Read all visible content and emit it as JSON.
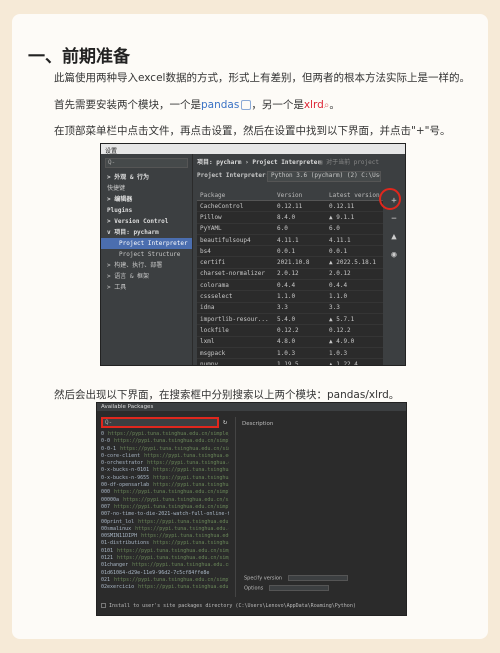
{
  "heading": "一、前期准备",
  "paragraphs": {
    "p1": "此篇使用两种导入excel数据的方式，形式上有差别，但两者的根本方法实际上是一样的。",
    "p2_before": "首先需要安装两个模块，一个是",
    "p2_pandas": "pandas",
    "p2_middle": "，另一个是",
    "p2_xlrd": "xlrd",
    "p2_end": "。",
    "p3": "在顶部菜单栏中点击文件，再点击设置，然后在设置中找到以下界面，并点击\"+\"号。",
    "p4": "然后会出现以下界面，在搜索框中分别搜索以上两个模块：pandas/xlrd。"
  },
  "settings": {
    "window_title": "设置",
    "search_placeholder": "Q-",
    "sidebar": [
      {
        "label": "> 外观 & 行为",
        "kind": "bold"
      },
      {
        "label": "  快捷键",
        "kind": "normal"
      },
      {
        "label": "> 编辑器",
        "kind": "bold"
      },
      {
        "label": "  Plugins",
        "kind": "bold"
      },
      {
        "label": "> Version Control",
        "kind": "bold"
      },
      {
        "label": "v 项目: pycharm",
        "kind": "bold"
      },
      {
        "label": "Project Interpreter",
        "kind": "active"
      },
      {
        "label": "Project Structure",
        "kind": "sub"
      },
      {
        "label": "> 构建、执行、部署",
        "kind": "normal"
      },
      {
        "label": "> 语言 & 框架",
        "kind": "normal"
      },
      {
        "label": "> 工具",
        "kind": "normal"
      }
    ],
    "breadcrumb": "项目: pycharm › Project Interpreter",
    "breadcrumb_right": "▣ 对于当前 project",
    "interpreter_label": "Project Interpreter:",
    "interpreter_value": "Python 3.6 (pycharm) (2) C:\\Use",
    "columns": [
      "Package",
      "Version",
      "Latest version"
    ],
    "packages": [
      [
        "CacheControl",
        "0.12.11",
        "0.12.11"
      ],
      [
        "Pillow",
        "8.4.0",
        "▲ 9.1.1"
      ],
      [
        "PyYAML",
        "6.0",
        "6.0"
      ],
      [
        "beautifulsoup4",
        "4.11.1",
        "4.11.1"
      ],
      [
        "bs4",
        "0.0.1",
        "0.0.1"
      ],
      [
        "certifi",
        "2021.10.8",
        "▲ 2022.5.18.1"
      ],
      [
        "charset-normalizer",
        "2.0.12",
        "2.0.12"
      ],
      [
        "colorama",
        "0.4.4",
        "0.4.4"
      ],
      [
        "cssselect",
        "1.1.0",
        "1.1.0"
      ],
      [
        "idna",
        "3.3",
        "3.3"
      ],
      [
        "importlib-resour...",
        "5.4.0",
        "▲ 5.7.1"
      ],
      [
        "lockfile",
        "0.12.2",
        "0.12.2"
      ],
      [
        "lxml",
        "4.8.0",
        "▲ 4.9.0"
      ],
      [
        "msgpack",
        "1.0.3",
        "1.0.3"
      ],
      [
        "numpy",
        "1.19.5",
        "▲ 1.22.4"
      ],
      [
        "pandas",
        "1.1.5",
        "▲ 1.4.2"
      ]
    ],
    "tools": [
      "+",
      "−",
      "▲",
      "◉"
    ]
  },
  "available": {
    "window_title": "Available Packages",
    "search_placeholder": "Q-",
    "refresh_icon": "↻",
    "description_label": "Description",
    "packages": [
      [
        "0",
        "https://pypi.tuna.tsinghua.edu.cn/simple/"
      ],
      [
        "0-0",
        "https://pypi.tuna.tsinghua.edu.cn/simple/"
      ],
      [
        "0-0-1",
        "https://pypi.tuna.tsinghua.edu.cn/simple/"
      ],
      [
        "0-core-client",
        "https://pypi.tuna.tsinghua.edu.cn/simple/"
      ],
      [
        "0-orchestrator",
        "https://pypi.tuna.tsinghua.edu.cn/simple/"
      ],
      [
        "0-x-bucks-n-0101",
        "https://pypi.tuna.tsinghua.edu.cn/simple/"
      ],
      [
        "0-x-bucks-n-9655",
        "https://pypi.tuna.tsinghua.edu.cn/simple/"
      ],
      [
        "00-df-opensarlab",
        "https://pypi.tuna.tsinghua.edu.cn/simple/"
      ],
      [
        "000",
        "https://pypi.tuna.tsinghua.edu.cn/simple/"
      ],
      [
        "00000a",
        "https://pypi.tuna.tsinghua.edu.cn/simple/"
      ],
      [
        "007",
        "https://pypi.tuna.tsinghua.edu.cn/simple/"
      ],
      [
        "007-no-time-to-die-2021-watch-full-online-free",
        ""
      ],
      [
        "00print_lol",
        "https://pypi.tuna.tsinghua.edu.cn/simple/"
      ],
      [
        "00smalinux",
        "https://pypi.tuna.tsinghua.edu.cn/simple/"
      ],
      [
        "00SMIN11DIPH",
        "https://pypi.tuna.tsinghua.edu.cn/simple/"
      ],
      [
        "01-distributions",
        "https://pypi.tuna.tsinghua.edu.cn/simple/"
      ],
      [
        "0101",
        "https://pypi.tuna.tsinghua.edu.cn/simple/"
      ],
      [
        "0121",
        "https://pypi.tuna.tsinghua.edu.cn/simple/"
      ],
      [
        "01changer",
        "https://pypi.tuna.tsinghua.edu.cn/simple/"
      ],
      [
        "01d61084-d29e-11e9-96d2-7c5cf84ffe8e",
        ""
      ],
      [
        "021",
        "https://pypi.tuna.tsinghua.edu.cn/simple/"
      ],
      [
        "02exercicio",
        "https://pypi.tuna.tsinghua.edu.cn/simple/"
      ]
    ],
    "specify_version": "Specify version",
    "options": "Options",
    "install_label": "Install to user's site packages directory (C:\\Users\\Lenovo\\AppData\\Roaming\\Python)"
  }
}
